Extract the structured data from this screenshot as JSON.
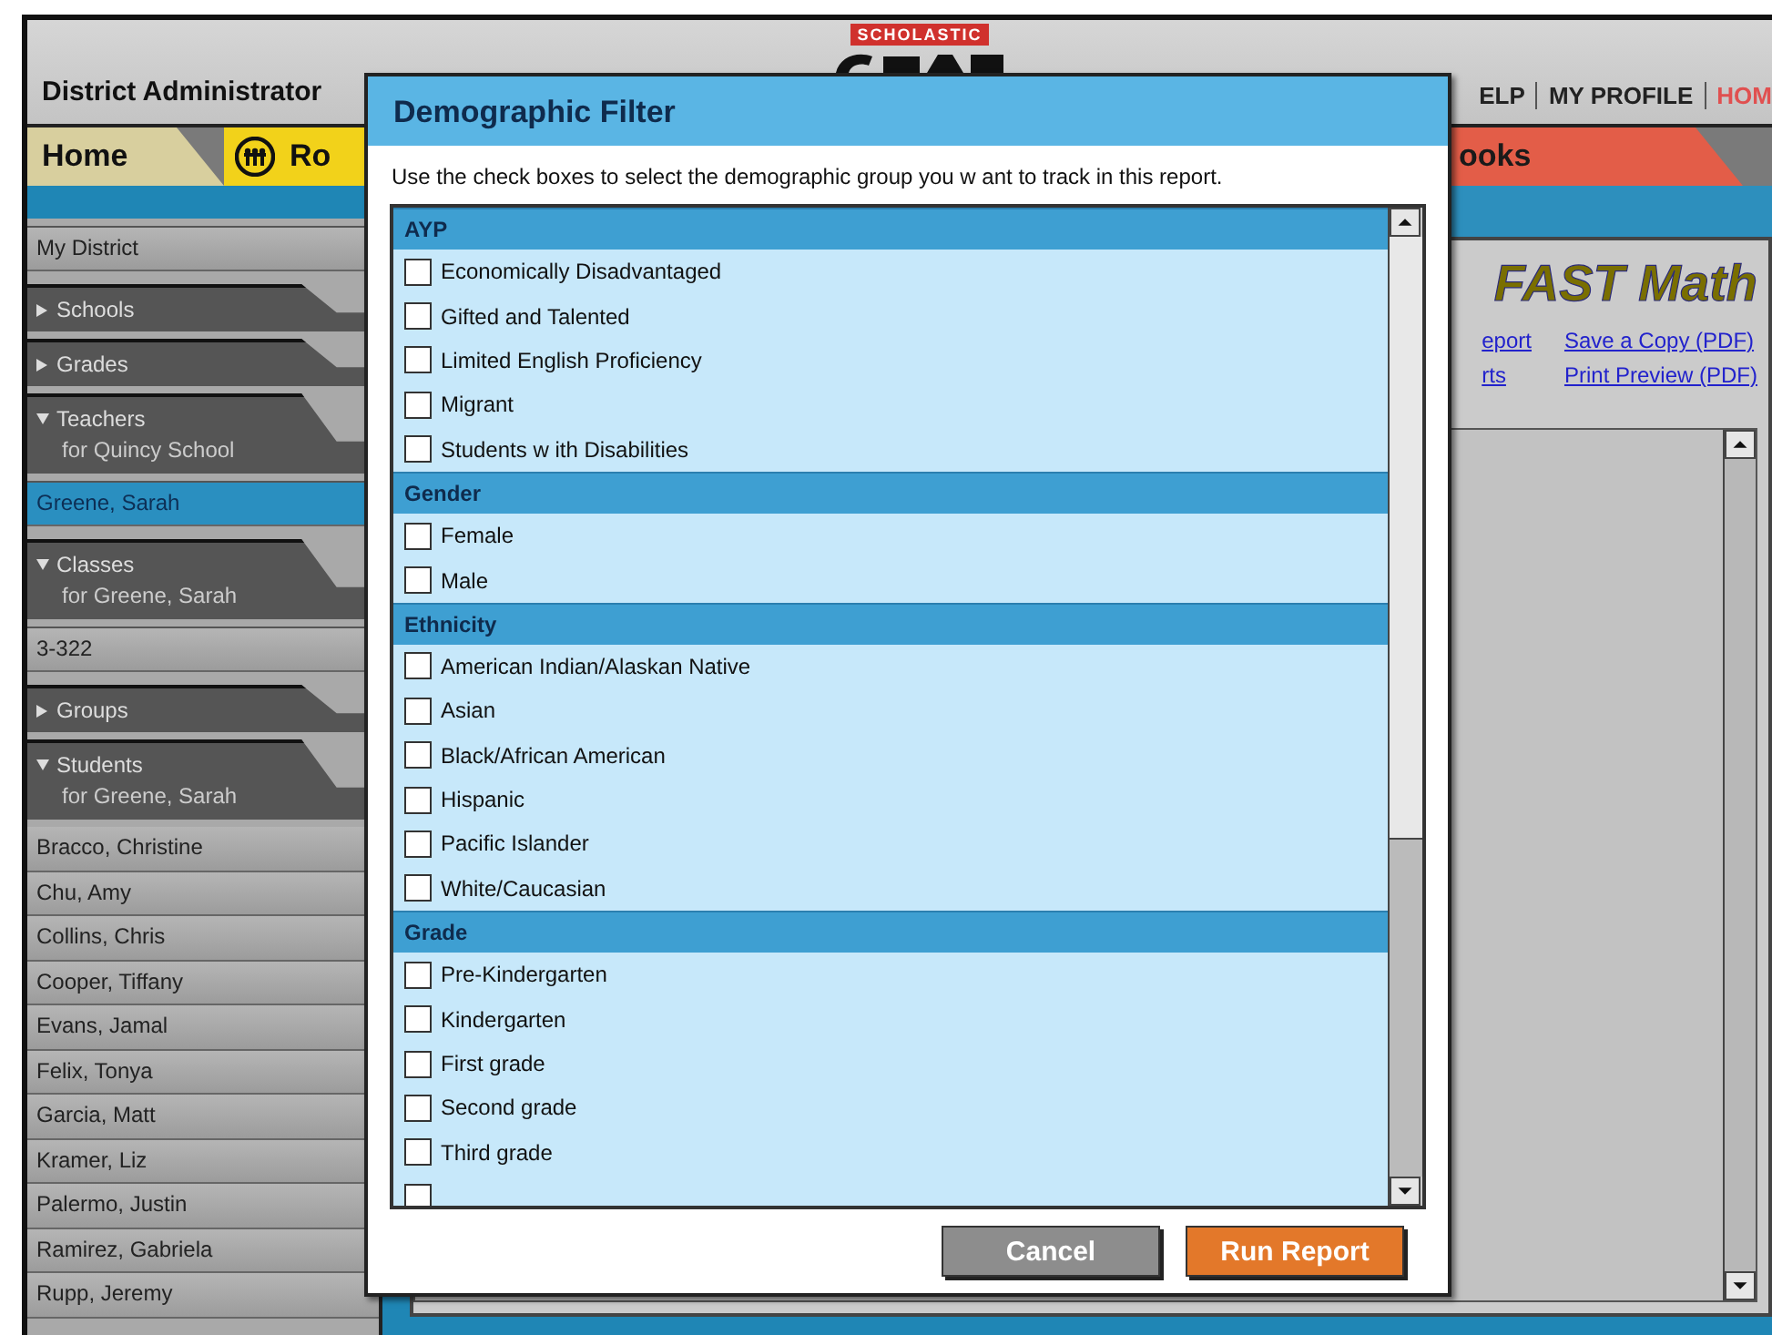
{
  "header": {
    "role": "District Administrator",
    "logo_brand": "SCHOLASTIC",
    "nav": [
      {
        "label": "ELP",
        "kind": "plain"
      },
      {
        "label": "MY PROFILE",
        "kind": "plain"
      },
      {
        "label": "HOM",
        "kind": "accent"
      }
    ]
  },
  "tabs": [
    {
      "label": "Home",
      "kind": "home"
    },
    {
      "label": "Ro",
      "kind": "roster"
    },
    {
      "label": "ooks",
      "kind": "books"
    }
  ],
  "sidebar": {
    "items": [
      {
        "kind": "link",
        "label": "My District",
        "selected": false
      },
      {
        "kind": "section",
        "label": "Schools",
        "expanded": false
      },
      {
        "kind": "section",
        "label": "Grades",
        "expanded": false
      },
      {
        "kind": "section",
        "label": "Teachers",
        "subtitle": "for Quincy School",
        "expanded": true
      },
      {
        "kind": "link",
        "label": "Greene, Sarah",
        "selected": true
      },
      {
        "kind": "section",
        "label": "Classes",
        "subtitle": "for Greene, Sarah",
        "expanded": true
      },
      {
        "kind": "link",
        "label": "3-322",
        "selected": false
      },
      {
        "kind": "section",
        "label": "Groups",
        "expanded": false
      },
      {
        "kind": "section",
        "label": "Students",
        "subtitle": "for Greene, Sarah",
        "expanded": true
      },
      {
        "kind": "student",
        "label": "Bracco, Christine",
        "selected": false
      },
      {
        "kind": "student",
        "label": "Chu, Amy",
        "selected": false
      },
      {
        "kind": "student",
        "label": "Collins, Chris",
        "selected": false
      },
      {
        "kind": "student",
        "label": "Cooper, Tiffany",
        "selected": false
      },
      {
        "kind": "student",
        "label": "Evans, Jamal",
        "selected": false
      },
      {
        "kind": "student",
        "label": "Felix, Tonya",
        "selected": false
      },
      {
        "kind": "student",
        "label": "Garcia, Matt",
        "selected": false
      },
      {
        "kind": "student",
        "label": "Kramer, Liz",
        "selected": false
      },
      {
        "kind": "student",
        "label": "Palermo, Justin",
        "selected": false
      },
      {
        "kind": "student",
        "label": "Ramirez, Gabriela",
        "selected": false
      },
      {
        "kind": "student",
        "label": "Rupp, Jeremy",
        "selected": false
      }
    ]
  },
  "report": {
    "logo": "FAST Math",
    "links": [
      "eport",
      "Save a Copy (PDF)",
      "rts",
      "Print Preview (PDF)"
    ]
  },
  "dialog": {
    "title": "Demographic Filter",
    "instruction": "Use the check boxes to select the demographic group you w ant to track in this report.",
    "groups": [
      {
        "label": "AYP",
        "options": [
          {
            "label": "Economically Disadvantaged",
            "checked": false
          },
          {
            "label": "Gifted and Talented",
            "checked": false
          },
          {
            "label": "Limited English Proficiency",
            "checked": false
          },
          {
            "label": "Migrant",
            "checked": false
          },
          {
            "label": "Students w ith Disabilities",
            "checked": false
          }
        ]
      },
      {
        "label": "Gender",
        "options": [
          {
            "label": "Female",
            "checked": false
          },
          {
            "label": "Male",
            "checked": false
          }
        ]
      },
      {
        "label": "Ethnicity",
        "options": [
          {
            "label": "American Indian/Alaskan Native",
            "checked": false
          },
          {
            "label": "Asian",
            "checked": false
          },
          {
            "label": "Black/African American",
            "checked": false
          },
          {
            "label": "Hispanic",
            "checked": false
          },
          {
            "label": "Pacific Islander",
            "checked": false
          },
          {
            "label": "White/Caucasian",
            "checked": false
          }
        ]
      },
      {
        "label": "Grade",
        "options": [
          {
            "label": "Pre-Kindergarten",
            "checked": false
          },
          {
            "label": "Kindergarten",
            "checked": false
          },
          {
            "label": "First grade",
            "checked": false
          },
          {
            "label": "Second grade",
            "checked": false
          },
          {
            "label": "Third grade",
            "checked": false
          },
          {
            "checked": false
          }
        ]
      }
    ],
    "buttons": [
      {
        "label": "Cancel",
        "kind": "secondary"
      },
      {
        "label": "Run Report",
        "kind": "primary"
      }
    ]
  }
}
